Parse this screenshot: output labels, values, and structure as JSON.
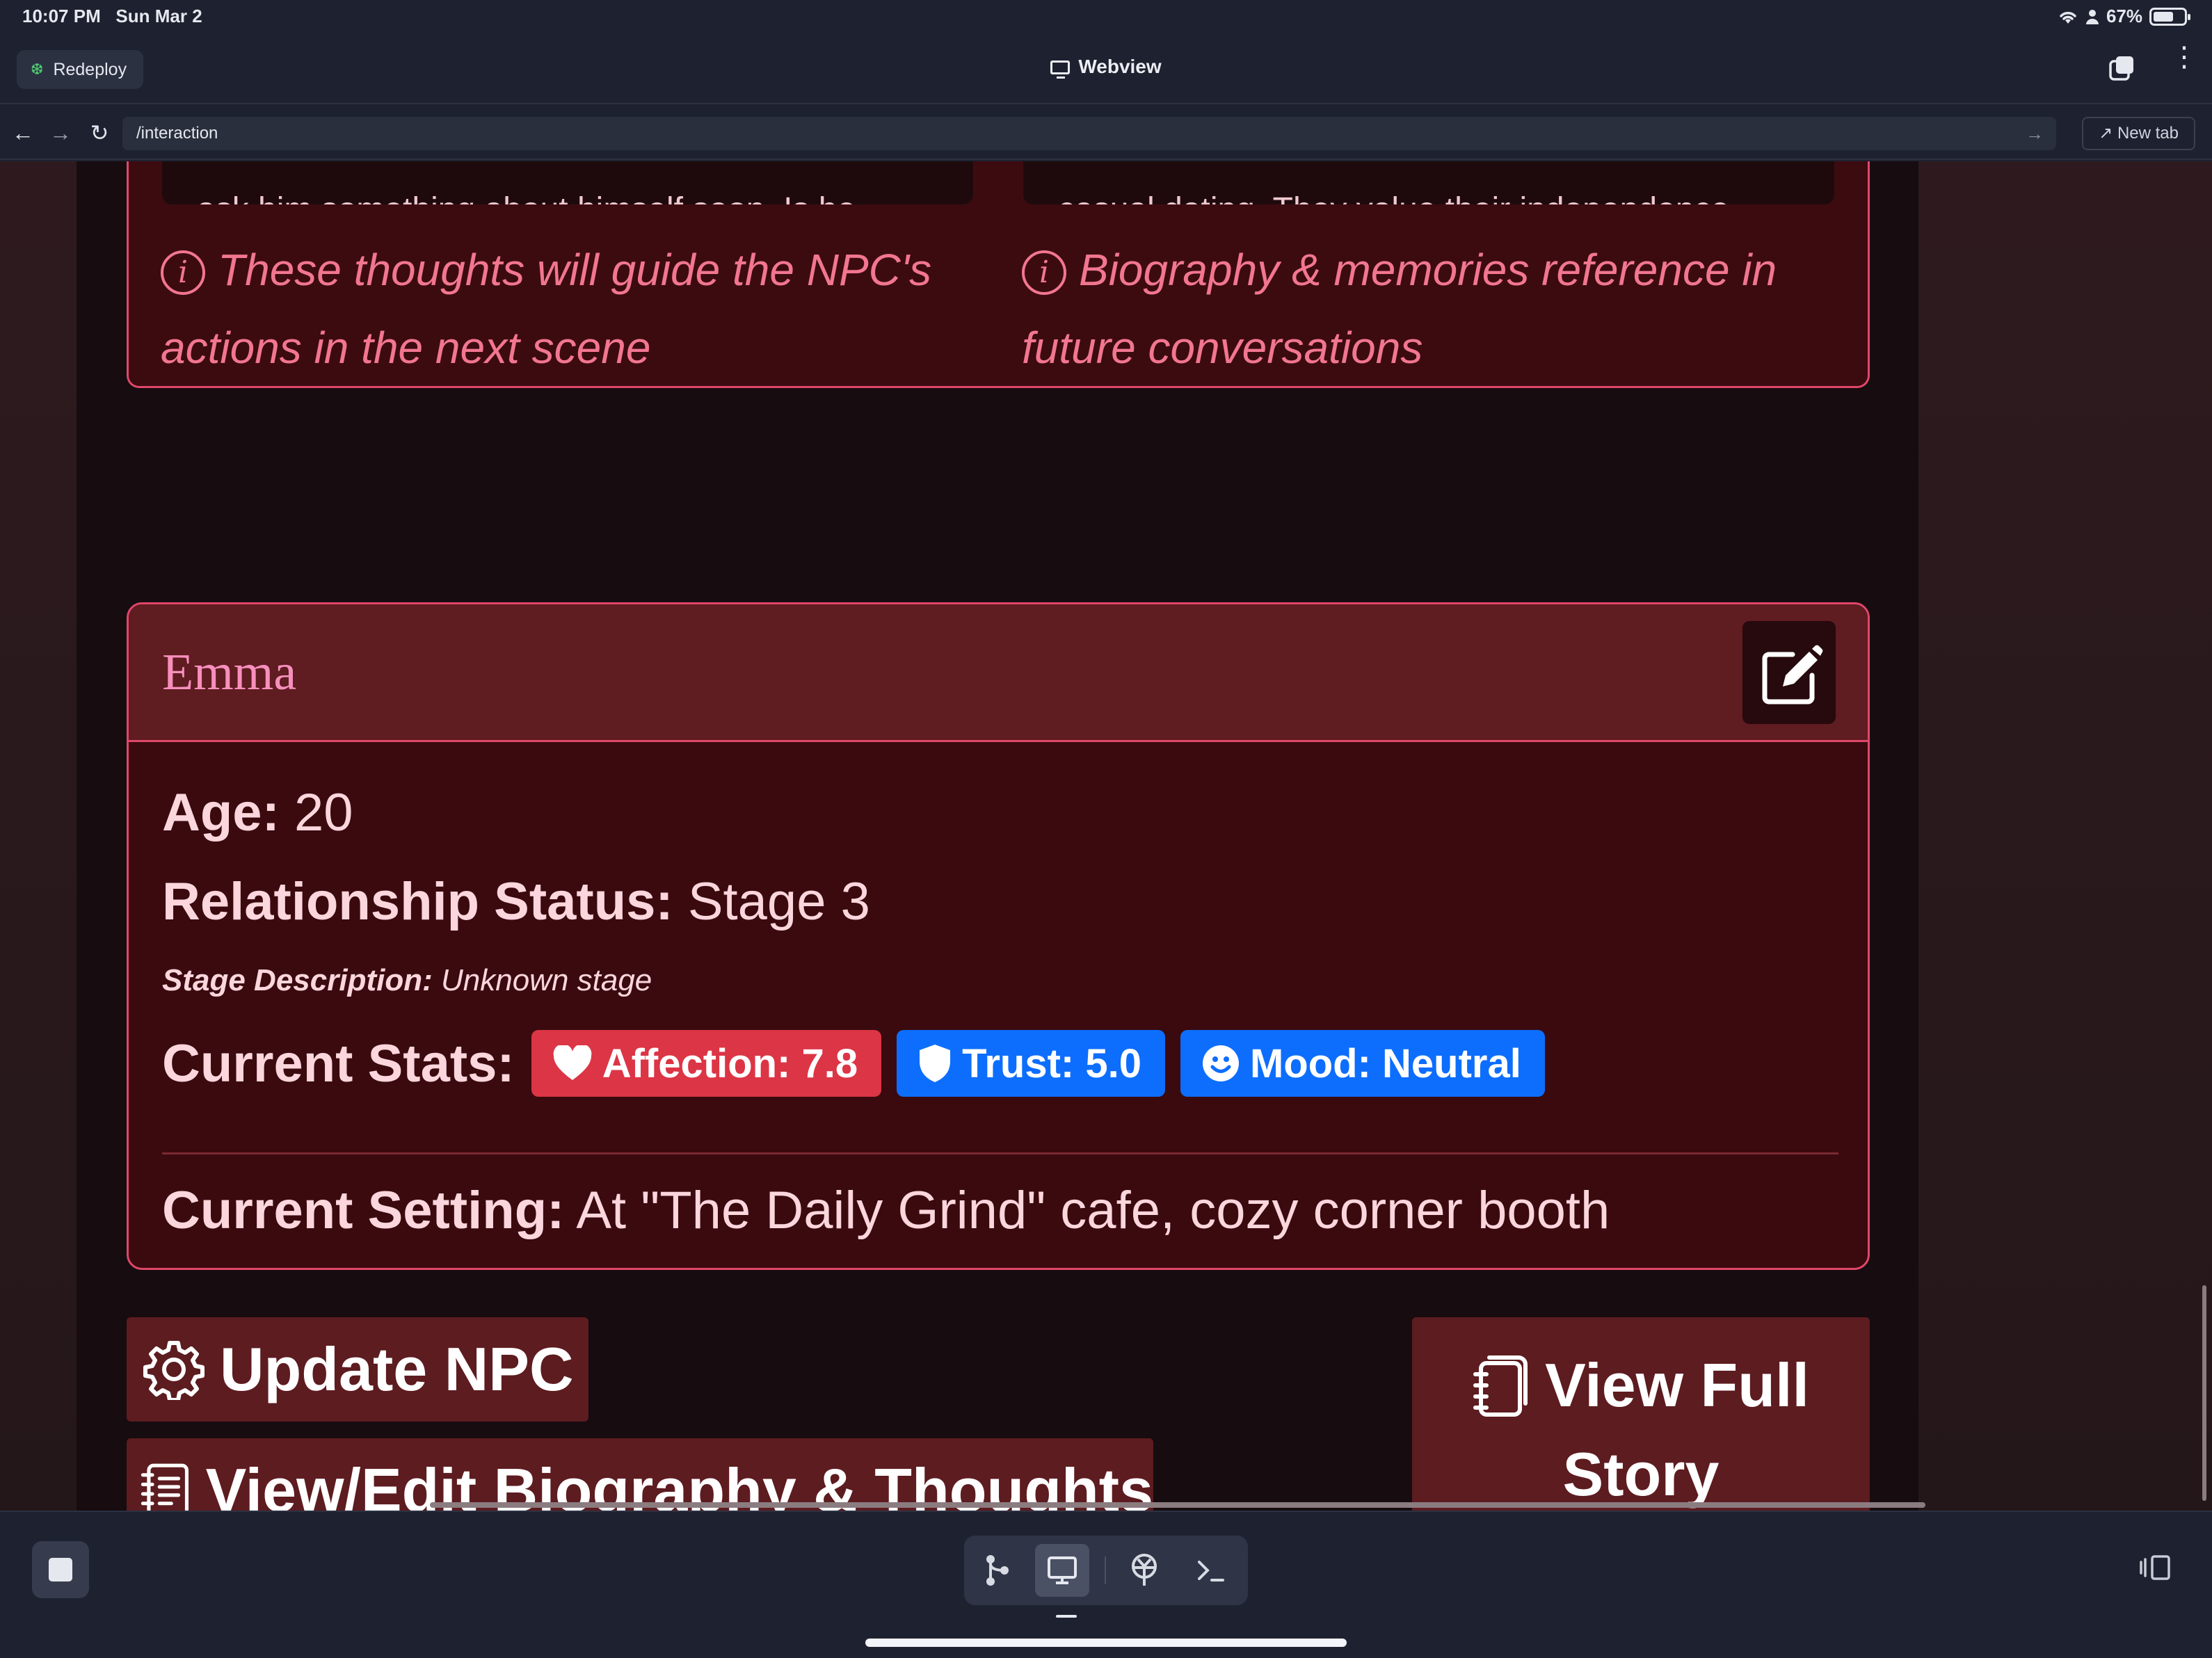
{
  "status_bar": {
    "time": "10:07 PM",
    "date": "Sun Mar 2",
    "battery": "67%",
    "battery_level": 0.67
  },
  "app_bar": {
    "redeploy_label": "Redeploy",
    "title": "Webview"
  },
  "url_bar": {
    "url": "/interaction",
    "new_tab_label": "New tab"
  },
  "upper_card": {
    "left_textarea_fragment": "ask him something about himself soon. Is he",
    "right_textarea_fragment": "casual dating. They value their independence",
    "left_hint": "These thoughts will guide the NPC's actions in the next scene",
    "right_hint": "Biography & memories reference in future conversations"
  },
  "npc": {
    "name": "Emma",
    "age_label": "Age:",
    "age": "20",
    "relationship_label": "Relationship Status:",
    "relationship": "Stage 3",
    "stage_desc_label": "Stage Description:",
    "stage_desc": "Unknown stage",
    "stats_label": "Current Stats:",
    "stats": {
      "affection": "Affection: 7.8",
      "trust": "Trust: 5.0",
      "mood": "Mood: Neutral"
    },
    "setting_label": "Current Setting:",
    "setting": "At \"The Daily Grind\" cafe, cozy corner booth"
  },
  "actions": {
    "update_npc": "Update NPC",
    "view_bio": "View/Edit Biography & Thoughts",
    "view_story_line1": "View Full",
    "view_story_line2": "Story"
  },
  "colors": {
    "accent_border": "#e0476a",
    "name_pink": "#f78fbd",
    "hint_pink": "#f2768f",
    "badge_red": "#dc3545",
    "badge_blue": "#0d6efd",
    "button_bg": "#5d1c20"
  },
  "icons": {
    "info": "info-circle-icon",
    "edit": "edit-square-icon",
    "heart": "heart-icon",
    "shield": "shield-icon",
    "smile": "smile-icon",
    "gear": "gear-icon",
    "journal": "journal-text-icon",
    "notebook": "journals-icon"
  }
}
